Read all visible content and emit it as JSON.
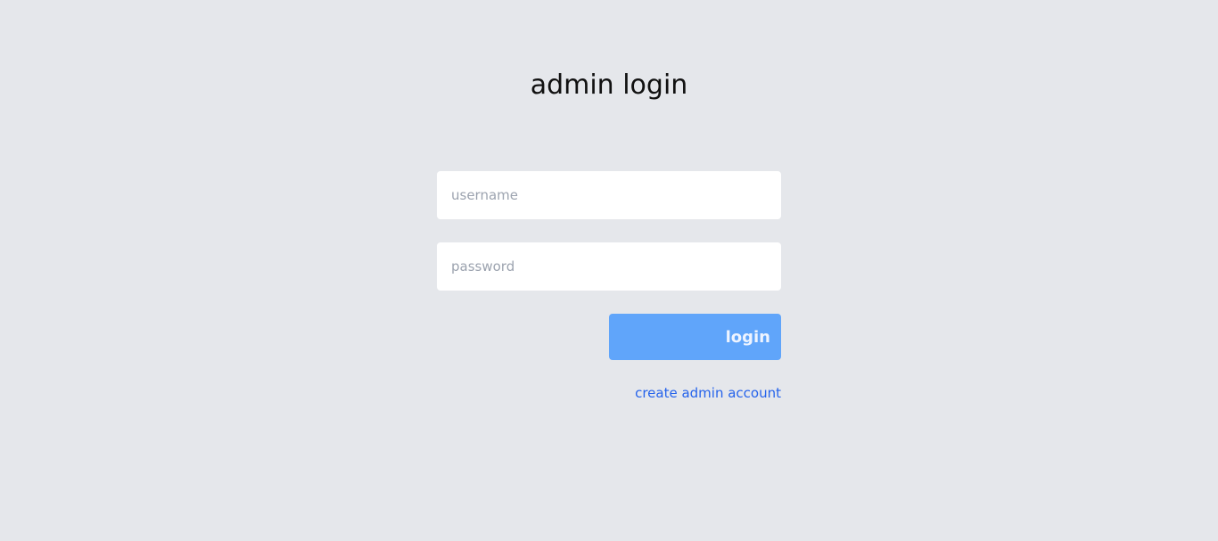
{
  "page": {
    "title": "admin login"
  },
  "form": {
    "username": {
      "value": "",
      "placeholder": "username"
    },
    "password": {
      "value": "",
      "placeholder": "password"
    },
    "submit_label": "login",
    "create_account_link": "create admin account"
  },
  "colors": {
    "background": "#e5e7eb",
    "button": "#60a5fa",
    "link": "#2563eb",
    "input_background": "#ffffff"
  }
}
